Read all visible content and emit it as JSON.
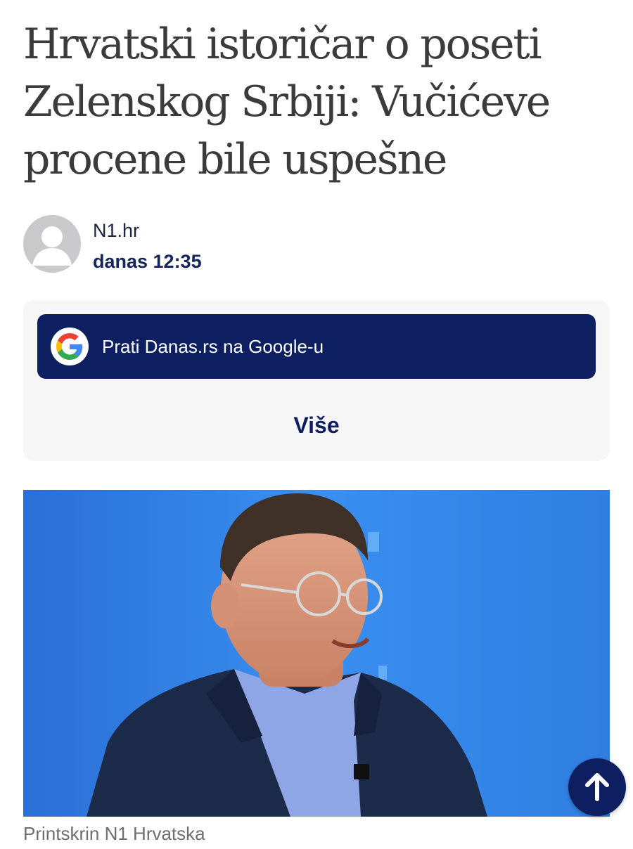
{
  "article": {
    "title": "Hrvatski istoričar o poseti Zelenskog Srbiji: Vučićeve procene bile uspešne",
    "author": "N1.hr",
    "date": "danas 12:35"
  },
  "follow": {
    "google_label": "Prati Danas.rs na Google-u",
    "more_label": "Više"
  },
  "photo": {
    "caption": "Printskrin N1 Hrvatska"
  },
  "icons": {
    "avatar": "default-user-avatar-icon",
    "google": "google-g-icon",
    "scroll_top": "arrow-up-icon"
  },
  "colors": {
    "navy": "#0d1f60",
    "title_text": "#3b3b3b",
    "photo_background": "#2f7ee0",
    "box_background": "#f6f6f7"
  }
}
